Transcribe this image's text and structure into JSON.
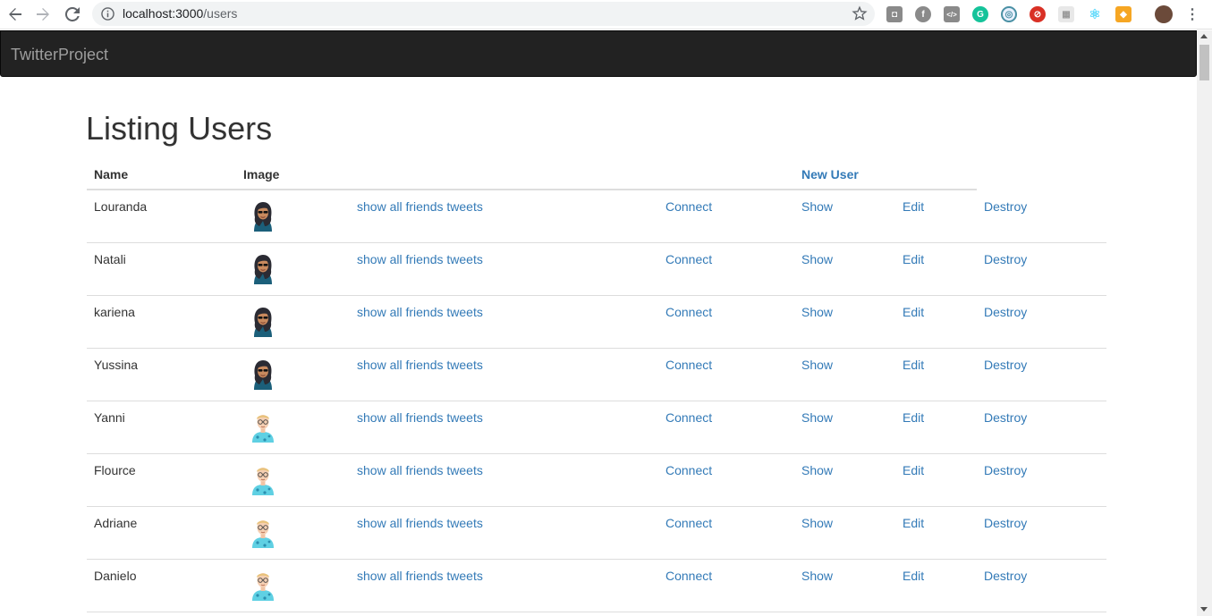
{
  "browser": {
    "url_host": "localhost:3000",
    "url_path": "/users"
  },
  "navbar": {
    "brand": "TwitterProject"
  },
  "page": {
    "title": "Listing Users"
  },
  "table": {
    "headers": {
      "name": "Name",
      "image": "Image",
      "new_user": "New User"
    },
    "links": {
      "friends_tweets": "show all friends tweets",
      "connect": "Connect",
      "show": "Show",
      "edit": "Edit",
      "destroy": "Destroy"
    },
    "rows": [
      {
        "name": "Louranda",
        "avatar": "female-avatar-icon"
      },
      {
        "name": "Natali",
        "avatar": "female-avatar-icon"
      },
      {
        "name": "kariena",
        "avatar": "female-avatar-icon"
      },
      {
        "name": "Yussina",
        "avatar": "female-avatar-icon"
      },
      {
        "name": "Yanni",
        "avatar": "male-avatar-icon"
      },
      {
        "name": "Flource",
        "avatar": "male-avatar-icon"
      },
      {
        "name": "Adriane",
        "avatar": "male-avatar-icon"
      },
      {
        "name": "Danielo",
        "avatar": "male-avatar-icon"
      }
    ]
  },
  "colors": {
    "navbar_bg": "#222222",
    "brand_text": "#9d9d9d",
    "link": "#337ab7",
    "text": "#333333"
  }
}
